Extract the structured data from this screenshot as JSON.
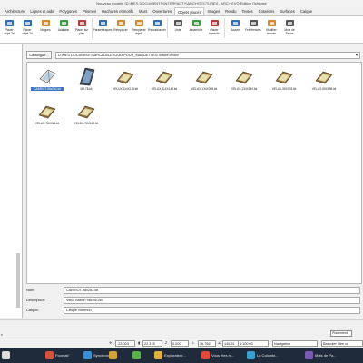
{
  "window": {
    "title": "Nouveau modèle [D:\\MES DOCUMENTS\\INTERFACTY\\ARCHITECTURE\\] - ARC+ EVO Edition Optimisé"
  },
  "ribbon_tabs": [
    {
      "label": "Architecture",
      "active": false
    },
    {
      "label": "Lignes et aide",
      "active": false
    },
    {
      "label": "Polygones",
      "active": false
    },
    {
      "label": "Prismes",
      "active": false
    },
    {
      "label": "Hachures et motifs",
      "active": false
    },
    {
      "label": "Murs",
      "active": false
    },
    {
      "label": "Ouvertures",
      "active": false
    },
    {
      "label": "Objets placés",
      "active": true
    },
    {
      "label": "Images",
      "active": false
    },
    {
      "label": "Rendu",
      "active": false
    },
    {
      "label": "Textes",
      "active": false
    },
    {
      "label": "Cotations",
      "active": false
    },
    {
      "label": "Surfaces",
      "active": false
    },
    {
      "label": "Calque",
      "active": false
    }
  ],
  "ribbon_buttons": [
    {
      "label": "Placer objet 2d",
      "icon": "object-2d-icon",
      "color": "#2f6db5"
    },
    {
      "label": "Placer objet 3d",
      "icon": "object-3d-icon",
      "color": "#2f6db5"
    },
    {
      "label": "Mappes",
      "icon": "mapping-icon",
      "color": "#d18a2c"
    },
    {
      "label": "Adalaine",
      "icon": "adalaine-icon",
      "color": "#3b9b3b"
    },
    {
      "label": "Placer sur plan",
      "icon": "place-plan-icon",
      "color": "#b33b3b"
    },
    {
      "label": "Paramétriques",
      "icon": "parametric-icon",
      "color": "#2f6db5"
    },
    {
      "label": "Remplacer",
      "icon": "replace-icon",
      "color": "#d18a2c"
    },
    {
      "label": "Remplacer objets",
      "icon": "replace-objects-icon",
      "color": "#d18a2c"
    },
    {
      "label": "Repositionner",
      "icon": "reposition-icon",
      "color": "#2f6db5"
    },
    {
      "label": "Liste",
      "icon": "list-icon",
      "color": "#555555"
    },
    {
      "label": "Assembler",
      "icon": "assemble-icon",
      "color": "#3b9b3b"
    },
    {
      "label": "Placer symbole",
      "icon": "symbol-icon",
      "color": "#b33b3b"
    },
    {
      "label": "Sauver",
      "icon": "save-icon",
      "color": "#2f6db5"
    },
    {
      "label": "Préférences",
      "icon": "preferences-icon",
      "color": "#555555"
    },
    {
      "label": "Modifier chemin",
      "icon": "edit-path-icon",
      "color": "#d18a2c"
    },
    {
      "label": "Mots de Passe",
      "icon": "password-icon",
      "color": "#555555"
    }
  ],
  "left_panel": {
    "items": [
      "",
      "",
      "",
      "",
      "",
      "",
      "",
      "",
      ""
    ]
  },
  "catalogue": {
    "button_label": "Catalogue...",
    "path": "D:\\MES DOCUMENTS\\ARCALIB-EVO\\3D-POUR_MAQUETTES\\Toiture\\Velux\\",
    "items": [
      {
        "name": "CABRIOT-98x252.kit",
        "selected": true,
        "kind": "cabriot"
      },
      {
        "name": "M9-78.kit",
        "selected": false,
        "kind": "dark"
      },
      {
        "name": "VELUX-114X118.kit",
        "selected": false,
        "kind": "velux"
      },
      {
        "name": "VELUX-114X140.kit",
        "selected": false,
        "kind": "velux"
      },
      {
        "name": "VELUX-134X098.kit",
        "selected": false,
        "kind": "velux"
      },
      {
        "name": "VELUX-134X140.kit",
        "selected": false,
        "kind": "velux"
      },
      {
        "name": "VELUX-55X078.kit",
        "selected": false,
        "kind": "velux"
      },
      {
        "name": "VELUX-55X098.kit",
        "selected": false,
        "kind": "velux"
      },
      {
        "name": "VELUX-78X118.kit",
        "selected": false,
        "kind": "velux"
      },
      {
        "name": "VELUX-78X140.kit",
        "selected": false,
        "kind": "velux"
      }
    ]
  },
  "form": {
    "nom_label": "Nom:",
    "nom_value": "CABRIOT-98x252.kit",
    "description_label": "Description:",
    "description_value": "Velux balcon 98x94/150",
    "calque_label": "Calque:",
    "calque_value": "Calque commun"
  },
  "status": {
    "placement_label": "Placement",
    "left_text": "e",
    "coord_x": "-23.003",
    "coord_y": "22.378",
    "coord_z": "0.000",
    "distance": "36.766",
    "angle": "145.91",
    "scale": "1:100.00",
    "mode": "Navigation",
    "hint": "Basculer filtre ca"
  },
  "taskbar": [
    {
      "label": "",
      "icon": "start-icon",
      "color": "#dddddd"
    },
    {
      "label": "Fournail",
      "icon": "fournail-icon",
      "color": "#d4523a"
    },
    {
      "label": "Synchronise...",
      "icon": "sync-icon",
      "color": "#3a8ed4"
    },
    {
      "label": "",
      "icon": "app-icon",
      "color": "#d4a23a"
    },
    {
      "label": "",
      "icon": "app-icon-2",
      "color": "#5ab04a"
    },
    {
      "label": "Explorateur...",
      "icon": "explorer-icon",
      "color": "#e0b040"
    },
    {
      "label": "Vous êtes m...",
      "icon": "chrome-icon",
      "color": "#e04a3a"
    },
    {
      "label": "Le Colombi...",
      "icon": "colombier-icon",
      "color": "#3aa0d0"
    },
    {
      "label": "Mots de Pa...",
      "icon": "keys-icon",
      "color": "#7a5ab0"
    }
  ]
}
